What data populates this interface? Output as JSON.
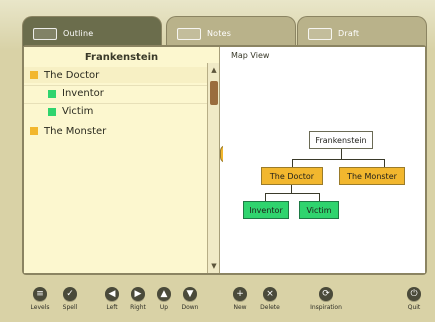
{
  "tabs": [
    {
      "label": "Outline",
      "icon": "outline-icon"
    },
    {
      "label": "Notes",
      "icon": "notes-icon"
    },
    {
      "label": "Draft",
      "icon": "draft-icon"
    }
  ],
  "outline": {
    "title": "Frankenstein",
    "items": [
      {
        "label": "The Doctor",
        "level": 0
      },
      {
        "label": "Inventor",
        "level": 1
      },
      {
        "label": "Victim",
        "level": 1
      },
      {
        "label": "The Monster",
        "level": 0
      }
    ]
  },
  "map": {
    "title": "Map View",
    "nodes": {
      "root": "Frankenstein",
      "doctor": "The Doctor",
      "monster": "The Monster",
      "inventor": "Inventor",
      "victim": "Victim"
    }
  },
  "toolbar": {
    "buttons": [
      {
        "label": "Levels",
        "icon": "levels-icon",
        "glyph": "≡"
      },
      {
        "label": "Spell",
        "icon": "spell-icon",
        "glyph": "✓"
      },
      {
        "label": "Left",
        "icon": "left-icon",
        "glyph": "◀"
      },
      {
        "label": "Right",
        "icon": "right-icon",
        "glyph": "▶"
      },
      {
        "label": "Up",
        "icon": "up-icon",
        "glyph": "▲"
      },
      {
        "label": "Down",
        "icon": "down-icon",
        "glyph": "▼"
      },
      {
        "label": "New",
        "icon": "new-icon",
        "glyph": "+"
      },
      {
        "label": "Delete",
        "icon": "delete-icon",
        "glyph": "×"
      },
      {
        "label": "Inspiration",
        "icon": "inspiration-icon",
        "glyph": "⟳"
      },
      {
        "label": "Quit",
        "icon": "quit-icon",
        "glyph": "⏻"
      }
    ]
  }
}
